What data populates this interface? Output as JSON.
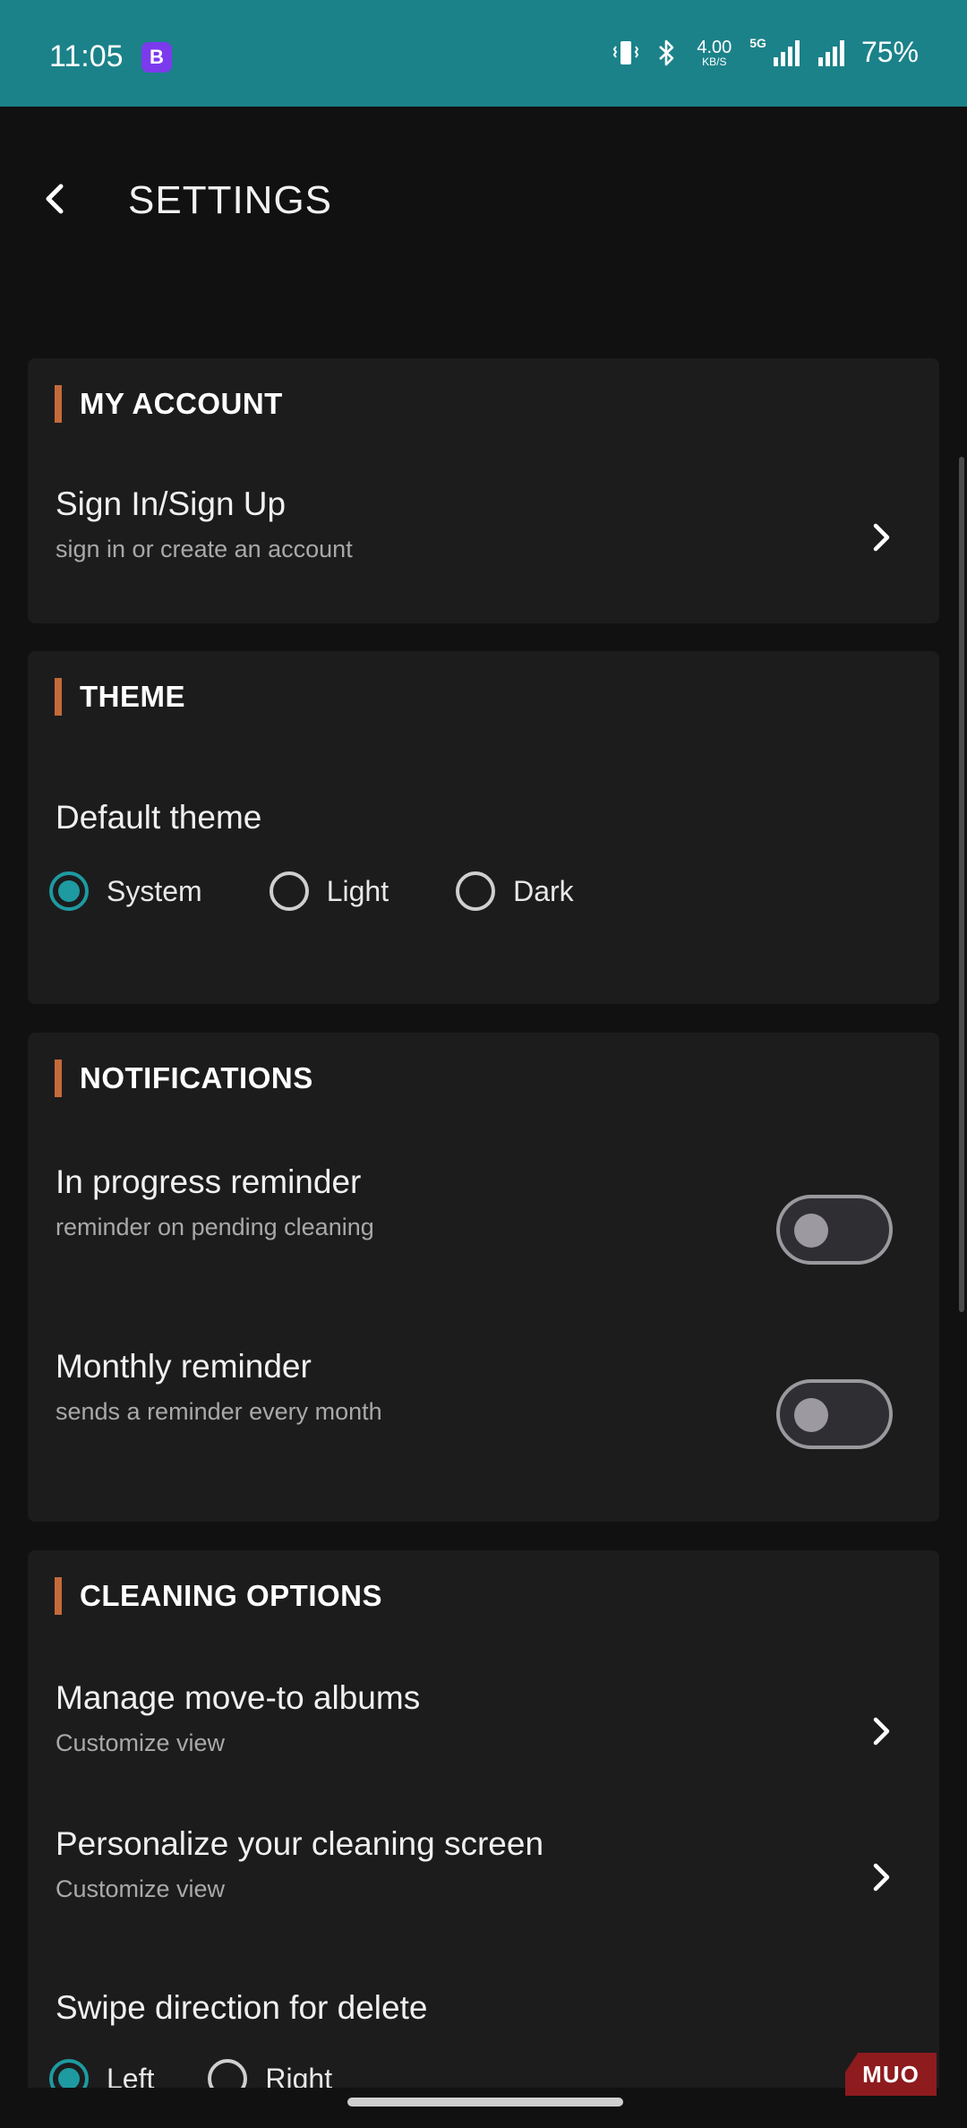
{
  "status_bar": {
    "time": "11:05",
    "app_badge": "B",
    "net_speed_value": "4.00",
    "net_speed_unit": "KB/S",
    "network_type": "5G",
    "battery": "75%"
  },
  "header": {
    "title": "SETTINGS"
  },
  "account": {
    "title": "MY ACCOUNT",
    "sign_in_title": "Sign In/Sign Up",
    "sign_in_sub": "sign in or create an account"
  },
  "theme": {
    "title": "THEME",
    "default_label": "Default theme",
    "options": [
      "System",
      "Light",
      "Dark"
    ],
    "selected": "System"
  },
  "notifications": {
    "title": "NOTIFICATIONS",
    "items": [
      {
        "title": "In progress reminder",
        "sub": "reminder on pending cleaning",
        "enabled": false
      },
      {
        "title": "Monthly reminder",
        "sub": "sends a reminder every month",
        "enabled": false
      }
    ]
  },
  "cleaning": {
    "title": "CLEANING OPTIONS",
    "items": [
      {
        "title": "Manage move-to albums",
        "sub": "Customize view"
      },
      {
        "title": "Personalize your cleaning screen",
        "sub": "Customize view"
      }
    ],
    "swipe_label": "Swipe direction for delete",
    "swipe_options": [
      "Left",
      "Right"
    ],
    "swipe_selected": "Left"
  },
  "watermark": "MUO",
  "colors": {
    "status_bar": "#1b8289",
    "accent": "#c46a3a",
    "radio_selected": "#1e9aa1",
    "background": "#111111",
    "card": "#1c1c1d"
  }
}
